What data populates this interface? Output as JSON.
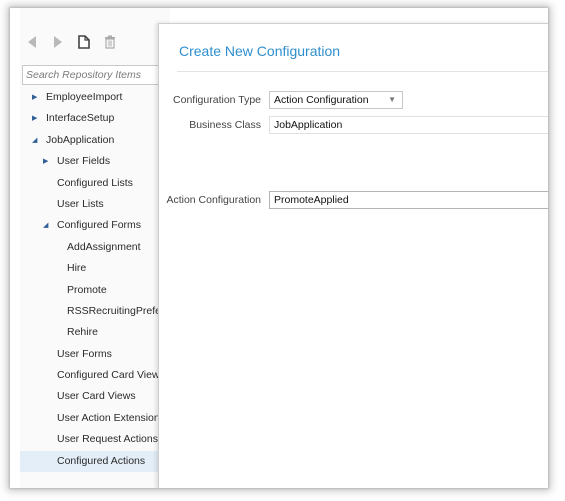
{
  "toolbar": {
    "back_icon": "back-arrow-icon",
    "forward_icon": "forward-arrow-icon",
    "new_icon": "new-document-icon",
    "delete_icon": "trash-icon"
  },
  "search": {
    "placeholder": "Search Repository Items"
  },
  "tree": {
    "items": [
      {
        "label": "EmployeeImport",
        "arrow": "▶"
      },
      {
        "label": "InterfaceSetup",
        "arrow": "▶"
      },
      {
        "label": "JobApplication",
        "arrow": "◢"
      },
      {
        "label": "User Fields",
        "arrow": "▶"
      },
      {
        "label": "Configured Lists",
        "arrow": ""
      },
      {
        "label": "User Lists",
        "arrow": ""
      },
      {
        "label": "Configured Forms",
        "arrow": "◢"
      },
      {
        "label": "AddAssignment",
        "arrow": ""
      },
      {
        "label": "Hire",
        "arrow": ""
      },
      {
        "label": "Promote",
        "arrow": ""
      },
      {
        "label": "RSSRecruitingPrefe",
        "arrow": ""
      },
      {
        "label": "Rehire",
        "arrow": ""
      },
      {
        "label": "User Forms",
        "arrow": ""
      },
      {
        "label": "Configured Card View",
        "arrow": ""
      },
      {
        "label": "User Card Views",
        "arrow": ""
      },
      {
        "label": "User Action Extension",
        "arrow": ""
      },
      {
        "label": "User Request Actions",
        "arrow": ""
      },
      {
        "label": "Configured Actions",
        "arrow": ""
      }
    ],
    "selected_label": "Configured Actions"
  },
  "form": {
    "title": "Create New Configuration",
    "configuration_type_label": "Configuration Type",
    "configuration_type_value": "Action Configuration",
    "business_class_label": "Business Class",
    "business_class_value": "JobApplication",
    "action_configuration_label": "Action Configuration",
    "action_configuration_value": "PromoteApplied"
  },
  "colors": {
    "title": "#2e8fce",
    "selection": "#e4eef8",
    "tree_arrow": "#2e5f96"
  }
}
